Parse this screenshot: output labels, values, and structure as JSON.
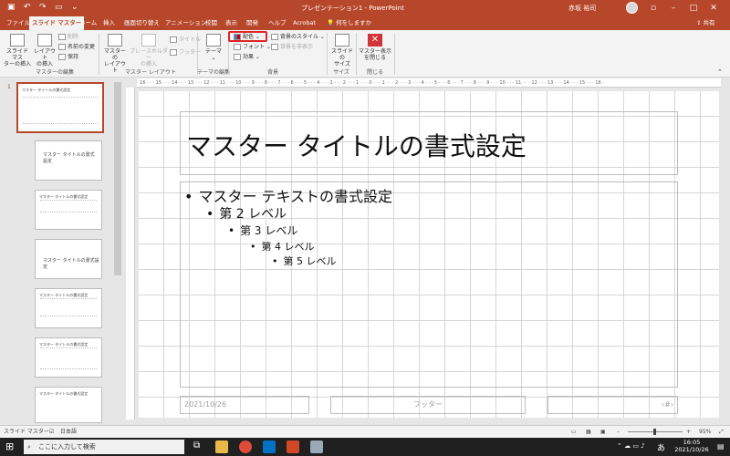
{
  "titlebar": {
    "title": "プレゼンテーション1  -  PowerPoint",
    "user": "赤坂 裕司"
  },
  "tabs": [
    {
      "label": "ファイル",
      "active": false
    },
    {
      "label": "スライド マスター",
      "active": true
    },
    {
      "label": "ホーム",
      "active": false
    },
    {
      "label": "挿入",
      "active": false
    },
    {
      "label": "画面切り替え",
      "active": false
    },
    {
      "label": "アニメーション",
      "active": false
    },
    {
      "label": "校閲",
      "active": false
    },
    {
      "label": "表示",
      "active": false
    },
    {
      "label": "開発",
      "active": false
    },
    {
      "label": "ヘルプ",
      "active": false
    },
    {
      "label": "Acrobat",
      "active": false
    },
    {
      "label": "何をしますか",
      "active": false
    }
  ],
  "share": "共有",
  "ribbon": {
    "insert_master": "スライド マス\nターの挿入",
    "insert_layout": "レイアウト\nの挿入",
    "delete": "削除",
    "rename": "名前の変更",
    "preserve": "保持",
    "g_master_edit": "マスターの編集",
    "master_layout": "マスターの\nレイアウト",
    "insert_placeholder": "プレースホルダー\nの挿入",
    "title_chk": "タイトル",
    "footer_chk": "フッター",
    "g_master_layout": "マスター レイアウト",
    "theme": "テーマ",
    "g_theme_edit": "テーマの編集",
    "colors": "配色",
    "fonts": "フォント",
    "effects": "効果",
    "bg_styles": "背景のスタイル",
    "hide_bg": "背景を非表示",
    "g_background": "背景",
    "slide_size": "スライドの\nサイズ",
    "g_size": "サイズ",
    "close_master": "マスター表示\nを閉じる",
    "g_close": "閉じる"
  },
  "thumbs": {
    "number": "1",
    "master_title": "マスター タイトルの書式設定",
    "layout_title": "マスター タイトルの書式設定"
  },
  "slide": {
    "title": "マスター タイトルの書式設定",
    "levels": [
      "マスター テキストの書式設定",
      "第 2 レベル",
      "第 3 レベル",
      "第 4 レベル",
      "第 5 レベル"
    ],
    "date": "2021/10/26",
    "footer": "フッター",
    "page": "‹#›"
  },
  "ruler": "· 16 · · · 15 · · · 14 · · · 13 · · · 12 · · · 11 · · · 10 · · · 9 · · · 8 · · · 7 · · · 6 · · · 5 · · · 4 · · · 3 · · · 2 · · · 1 · · · 0 · · · 1 · · · 2 · · · 3 · · · 4 · · · 5 · · · 6 · · · 7 · · · 8 · · · 9 · · · 10 · · · 11 · · · 12 · · · 13 · · · 14 · · · 15 · · · 16 ·",
  "status": {
    "view": "スライド マスター",
    "lang": "日本語",
    "zoom": "95%"
  },
  "taskbar": {
    "search": "ここに入力して検索",
    "time": "16:05",
    "date": "2021/10/26",
    "ime": "あ"
  },
  "colors": {
    "accent": "#b7472a",
    "highlight": "#e0242a"
  }
}
